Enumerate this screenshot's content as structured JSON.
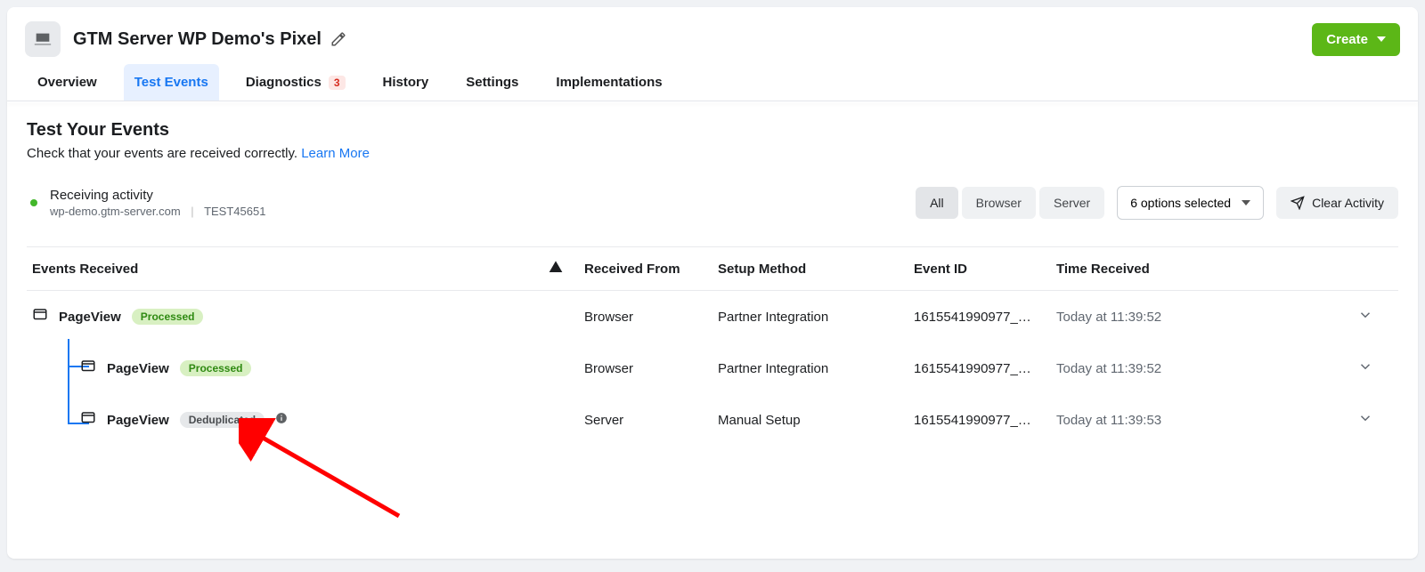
{
  "header": {
    "title": "GTM Server WP Demo's Pixel",
    "create_label": "Create"
  },
  "tabs": {
    "overview": "Overview",
    "test_events": "Test Events",
    "diagnostics": "Diagnostics",
    "diagnostics_badge": "3",
    "history": "History",
    "settings": "Settings",
    "implementations": "Implementations"
  },
  "section": {
    "title": "Test Your Events",
    "subtitle": "Check that your events are received correctly. ",
    "learn_more": "Learn More"
  },
  "activity": {
    "line1": "Receiving activity",
    "domain": "wp-demo.gtm-server.com",
    "test_id": "TEST45651"
  },
  "filters": {
    "all": "All",
    "browser": "Browser",
    "server": "Server",
    "options": "6 options selected",
    "clear": "Clear Activity"
  },
  "columns": {
    "events": "Events Received",
    "from": "Received From",
    "setup": "Setup Method",
    "event_id": "Event ID",
    "time": "Time Received"
  },
  "rows": [
    {
      "name": "PageView",
      "status": "Processed",
      "status_type": "green",
      "from": "Browser",
      "setup": "Partner Integration",
      "event_id": "1615541990977_…",
      "time": "Today at 11:39:52",
      "indent": 0
    },
    {
      "name": "PageView",
      "status": "Processed",
      "status_type": "green",
      "from": "Browser",
      "setup": "Partner Integration",
      "event_id": "1615541990977_…",
      "time": "Today at 11:39:52",
      "indent": 1
    },
    {
      "name": "PageView",
      "status": "Deduplicated",
      "status_type": "grey",
      "from": "Server",
      "setup": "Manual Setup",
      "event_id": "1615541990977_…",
      "time": "Today at 11:39:53",
      "indent": 1,
      "info": true
    }
  ]
}
